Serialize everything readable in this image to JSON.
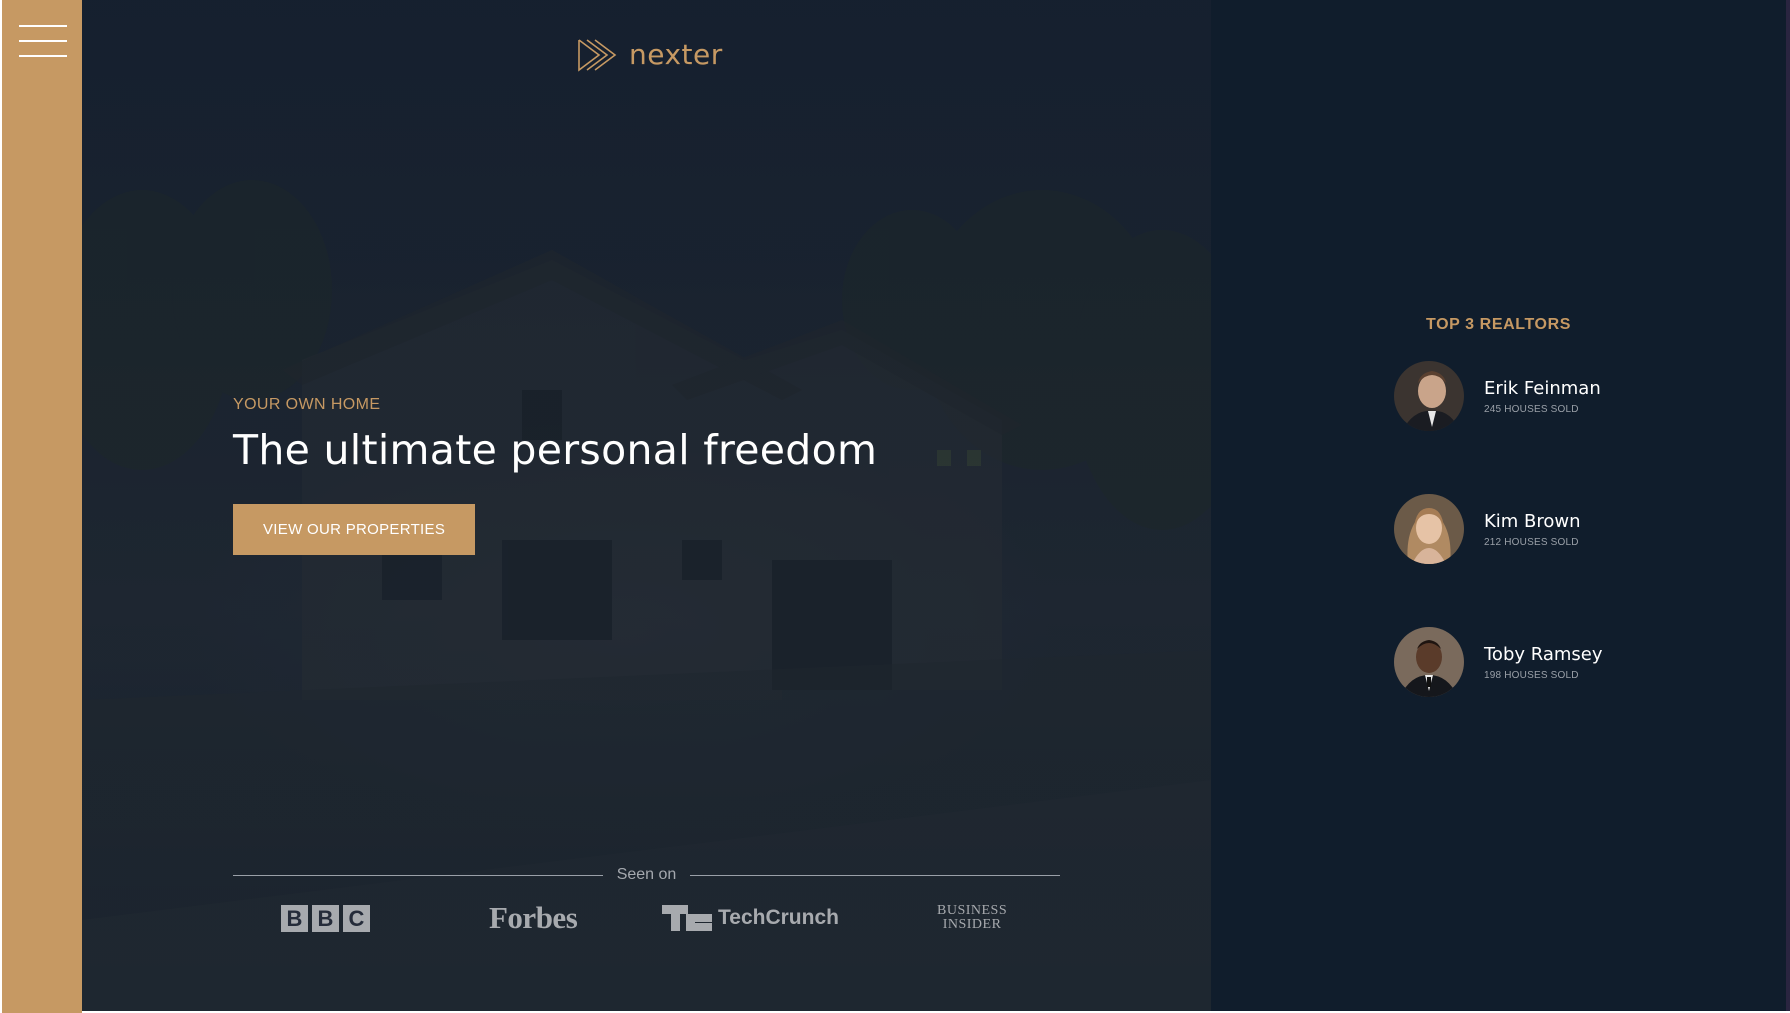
{
  "brand": {
    "name": "nexter",
    "accent_color": "#c69963",
    "dark_color": "#101d2c"
  },
  "sidebar": {
    "menu_icon": "hamburger-menu-icon"
  },
  "hero": {
    "subtitle": "YOUR OWN HOME",
    "heading": "The ultimate personal freedom",
    "cta_label": "VIEW OUR PROPERTIES",
    "seen_on_label": "Seen on",
    "press": {
      "bbc": [
        "B",
        "B",
        "C"
      ],
      "forbes": "Forbes",
      "techcrunch": "TechCrunch",
      "business_insider_line1": "BUSINESS",
      "business_insider_line2": "INSIDER"
    }
  },
  "realtors": {
    "title": "TOP 3 REALTORS",
    "items": [
      {
        "name": "Erik Feinman",
        "sold": "245 HOUSES SOLD"
      },
      {
        "name": "Kim Brown",
        "sold": "212 HOUSES SOLD"
      },
      {
        "name": "Toby Ramsey",
        "sold": "198 HOUSES SOLD"
      }
    ]
  }
}
